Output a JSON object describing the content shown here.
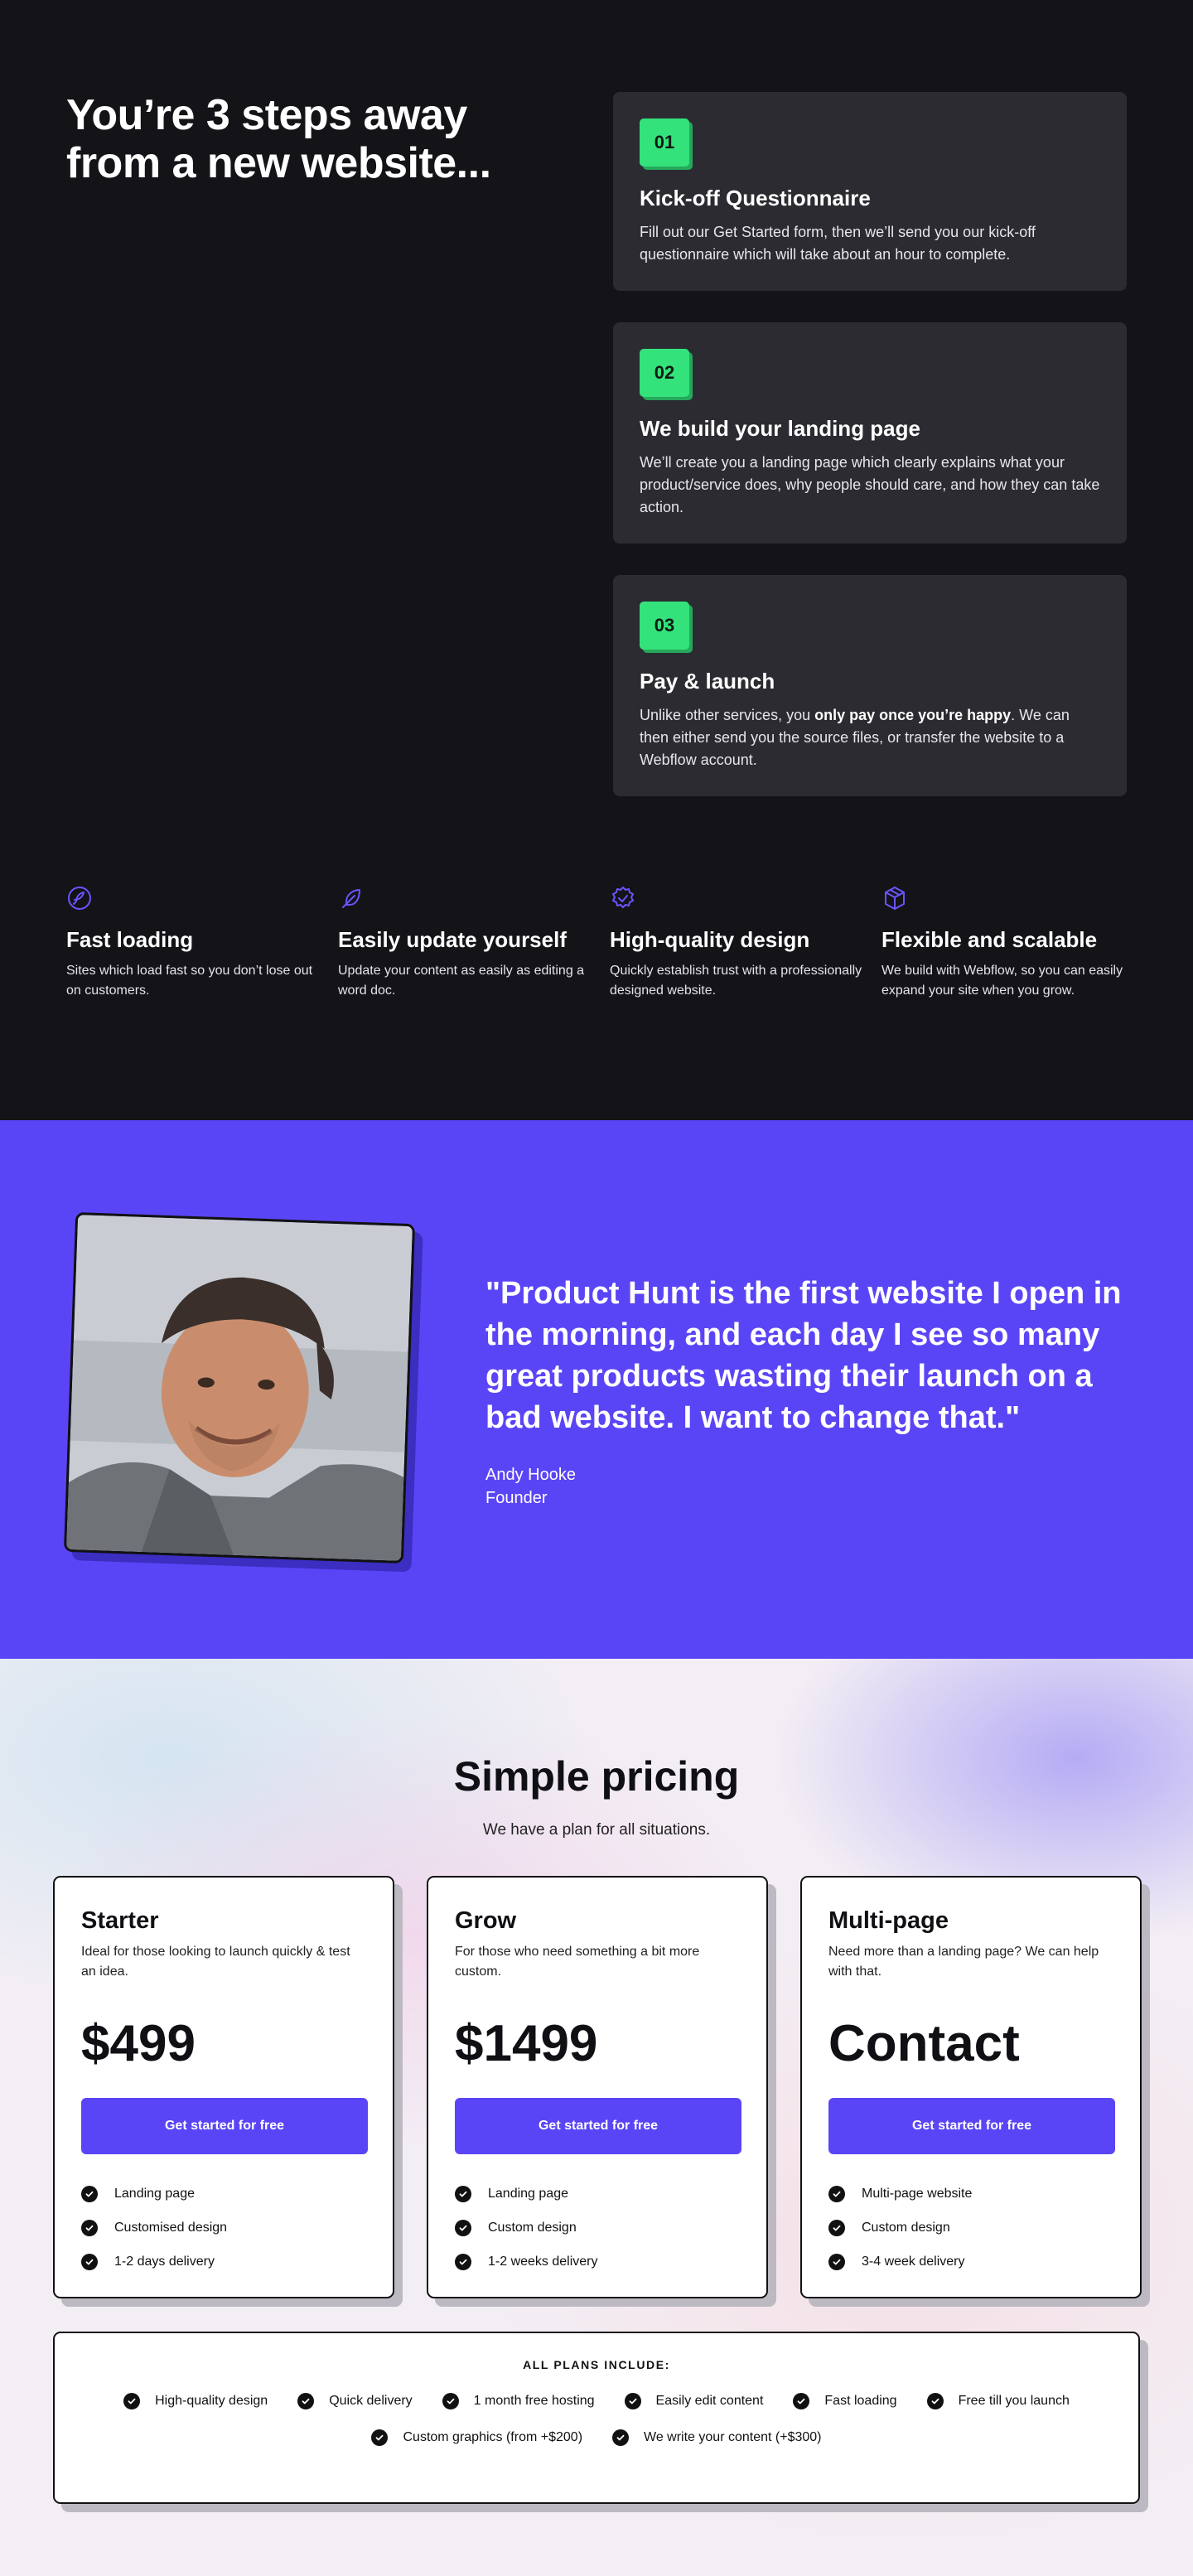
{
  "steps": {
    "title": "You’re 3 steps away from a  new website...",
    "items": [
      {
        "number": "01",
        "title": "Kick-off Questionnaire",
        "body": "Fill out our Get Started form, then we’ll send you our kick-off questionnaire which will take about an hour to complete."
      },
      {
        "number": "02",
        "title": "We build your landing page",
        "body": "We’ll create you a landing page which clearly explains what your product/service does, why people should care, and how they can take action."
      },
      {
        "number": "03",
        "title": "Pay & launch",
        "body_before": "Unlike other services, you ",
        "body_bold": "only pay once you’re happy",
        "body_after": ". We can then either send you the source files, or transfer the website to a Webflow account."
      }
    ]
  },
  "features": [
    {
      "icon": "rocket-icon",
      "title": "Fast loading",
      "body": "Sites which load fast so you don’t lose out on customers."
    },
    {
      "icon": "feather-icon",
      "title": "Easily update yourself",
      "body": "Update your content as easily as editing a word doc."
    },
    {
      "icon": "verified-badge-icon",
      "title": "High-quality design",
      "body": "Quickly establish trust with a professionally designed website."
    },
    {
      "icon": "cube-icon",
      "title": "Flexible and scalable",
      "body": "We build with Webflow, so you can easily expand your site when you grow."
    }
  ],
  "testimonial": {
    "quote": "\"Product Hunt is the first website I open in the morning, and each day I see so many great products wasting their launch on a bad website. I want to change that.\"",
    "name": "Andy Hooke",
    "role": "Founder"
  },
  "pricing": {
    "title": "Simple pricing",
    "subtitle": "We have a plan for all situations.",
    "plans": [
      {
        "name": "Starter",
        "desc": "Ideal for those looking to launch quickly & test an idea.",
        "price": "$499",
        "cta": "Get started for free",
        "features": [
          "Landing page",
          "Customised design",
          "1-2 days delivery"
        ]
      },
      {
        "name": "Grow",
        "desc": "For those who need something a bit more custom.",
        "price": "$1499",
        "cta": "Get started for free",
        "features": [
          "Landing page",
          "Custom design",
          "1-2 weeks delivery"
        ]
      },
      {
        "name": "Multi-page",
        "desc": "Need more than a landing page? We can help with that.",
        "price": "Contact",
        "cta": "Get started for free",
        "features": [
          "Multi-page website",
          "Custom design",
          "3-4 week delivery"
        ]
      }
    ],
    "includes": {
      "title": "ALL PLANS INCLUDE:",
      "row1": [
        "High-quality design",
        "Quick delivery",
        "1 month free hosting",
        "Easily edit content",
        "Fast loading",
        "Free till you launch"
      ],
      "row2": [
        "Custom graphics (from +$200)",
        "We write your content (+$300)"
      ]
    }
  },
  "colors": {
    "accent": "#5a45f6",
    "badge": "#34e27c",
    "dark_bg": "#131318",
    "card_bg": "#2b2b31"
  }
}
